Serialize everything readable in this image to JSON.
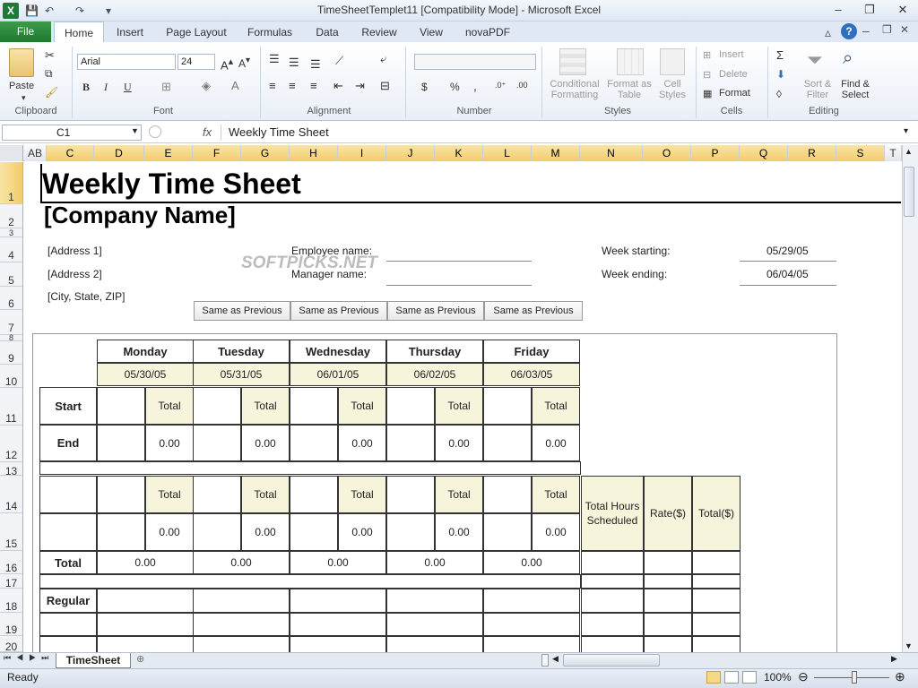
{
  "window": {
    "title": "TimeSheetTemplet11  [Compatibility Mode] - Microsoft Excel",
    "app_icon": "X",
    "minimize": "–",
    "restore": "❐",
    "close": "✕"
  },
  "qat": {
    "save": "💾",
    "undo": "↶",
    "redo": "↷",
    "customize": "▾"
  },
  "ribbon_tabs": [
    "File",
    "Home",
    "Insert",
    "Page Layout",
    "Formulas",
    "Data",
    "Review",
    "View",
    "novaPDF"
  ],
  "ribbon": {
    "clipboard": {
      "paste": "Paste",
      "label": "Clipboard"
    },
    "font": {
      "name": "Arial",
      "size": "24",
      "label": "Font",
      "bold": "B",
      "italic": "I",
      "underline": "U"
    },
    "alignment": {
      "label": "Alignment"
    },
    "number": {
      "format": "",
      "currency": "$",
      "percent": "%",
      "comma": ",",
      "label": "Number"
    },
    "styles": {
      "conditional": "Conditional Formatting",
      "format_table": "Format as Table",
      "cell_styles": "Cell Styles",
      "label": "Styles"
    },
    "cells": {
      "insert": "Insert",
      "delete": "Delete",
      "format": "Format",
      "label": "Cells"
    },
    "editing": {
      "sigma": "Σ",
      "sort": "Sort & Filter",
      "find": "Find & Select",
      "label": "Editing"
    }
  },
  "formula_bar": {
    "name_box": "C1",
    "fx": "fx",
    "content": "Weekly Time Sheet"
  },
  "columns": [
    "AB",
    "C",
    "D",
    "E",
    "F",
    "G",
    "H",
    "I",
    "J",
    "K",
    "L",
    "M",
    "N",
    "O",
    "P",
    "Q",
    "R",
    "S",
    "T"
  ],
  "rows": [
    "1",
    "2",
    "3",
    "4",
    "5",
    "6",
    "7",
    "8",
    "9",
    "10",
    "11",
    "12",
    "13",
    "14",
    "15",
    "16",
    "17",
    "18",
    "19",
    "20"
  ],
  "sheet": {
    "title": "Weekly Time Sheet",
    "company": "[Company Name]",
    "address1": "[Address 1]",
    "address2": "[Address 2]",
    "city": "[City, State, ZIP]",
    "employee_label": "Employee name:",
    "manager_label": "Manager name:",
    "week_start_label": "Week starting:",
    "week_start": "05/29/05",
    "week_end_label": "Week ending:",
    "week_end": "06/04/05",
    "watermark": "SOFTPICKS.NET",
    "same_prev": [
      "Same as Previous",
      "Same as Previous",
      "Same as Previous",
      "Same as Previous"
    ],
    "days": [
      "Monday",
      "Tuesday",
      "Wednesday",
      "Thursday",
      "Friday"
    ],
    "dates": [
      "05/30/05",
      "05/31/05",
      "06/01/05",
      "06/02/05",
      "06/03/05"
    ],
    "start_label": "Start",
    "end_label": "End",
    "total_word": "Total",
    "zero": "0.00",
    "total_row_label": "Total",
    "total_hours_label": "Total Hours Scheduled",
    "rate_label": "Rate($)",
    "total_dollar_label": "Total($)",
    "regular_label": "Regular"
  },
  "sheet_tab": "TimeSheet",
  "status": {
    "ready": "Ready",
    "zoom": "100%"
  }
}
